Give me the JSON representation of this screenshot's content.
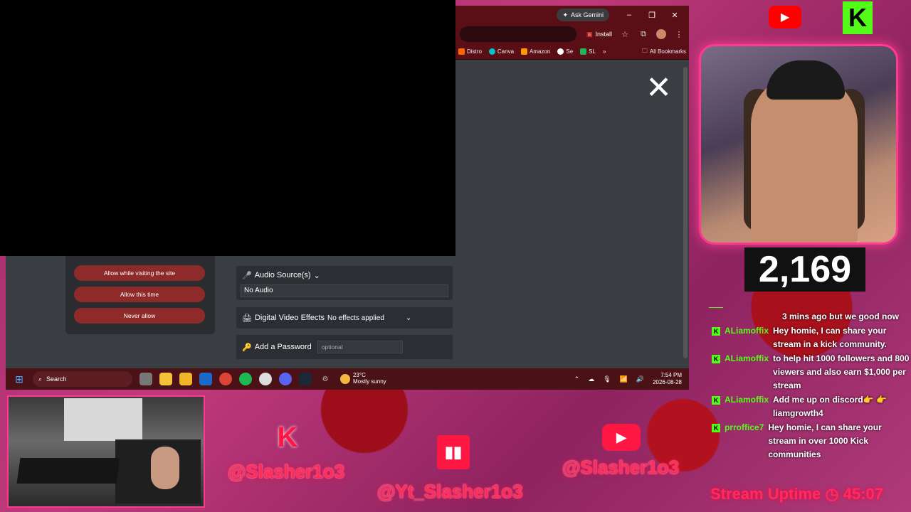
{
  "browser": {
    "gemini_label": "Ask Gemini",
    "install_label": "Install",
    "bookmarks": [
      {
        "label": "Distro",
        "color": "#ff6a00"
      },
      {
        "label": "Canva",
        "color": "#00c4cc"
      },
      {
        "label": "Amazon",
        "color": "#ff9900"
      },
      {
        "label": "Se",
        "color": "#ffffff"
      },
      {
        "label": "SL",
        "color": "#1db954"
      }
    ],
    "all_bookmarks_label": "All Bookmarks"
  },
  "permission": {
    "allow_visiting": "Allow while visiting the site",
    "allow_once": "Allow this time",
    "never_allow": "Never allow"
  },
  "settings": {
    "audio_label": "Audio Source(s)",
    "audio_value": "No Audio",
    "effects_label": "Digital Video Effects",
    "effects_value": "No effects applied",
    "password_label": "Add a Password",
    "password_placeholder": "optional"
  },
  "taskbar": {
    "search_label": "Search",
    "temp": "23°C",
    "weather": "Mostly sunny",
    "time": "7:54 PM",
    "date": "2026-08-28"
  },
  "overlay": {
    "follower_count": "2,169",
    "chat": [
      {
        "user": "",
        "text": "3 mins ago but we good now"
      },
      {
        "user": "ALiamoffix",
        "text": "Hey homie, I can share your stream in a kick community."
      },
      {
        "user": "ALiamoffix",
        "text": "to help hit 1000 followers and 800 viewers and also earn $1,000 per stream"
      },
      {
        "user": "ALiamoffix",
        "text": "Add me up on discord👉 👉 liamgrowth4"
      },
      {
        "user": "prroffice7",
        "text": "Hey homie, I can share your stream in over 1000 Kick communities"
      }
    ],
    "kick_handle": "@Slasher1o3",
    "twitch_handle": "@Yt_Slasher1o3",
    "youtube_handle": "@Slasher1o3",
    "uptime_label": "Stream Uptime",
    "uptime_value": "45:07"
  }
}
